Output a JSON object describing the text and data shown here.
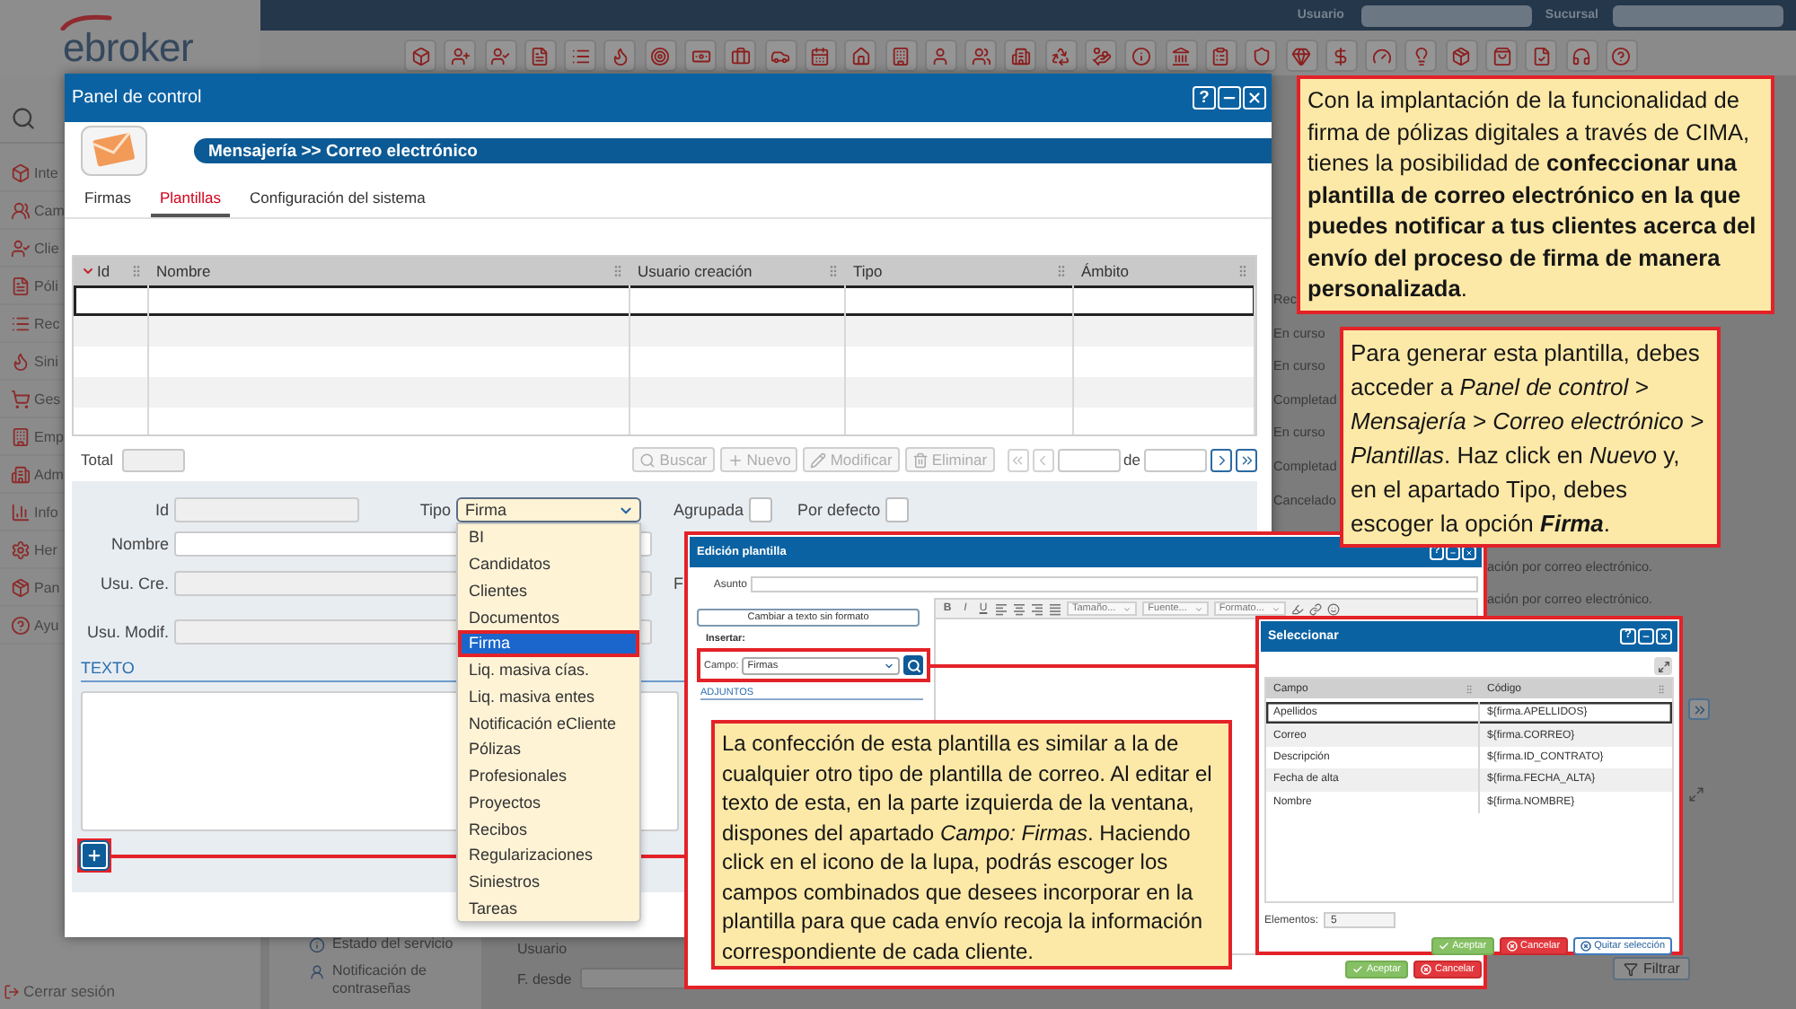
{
  "app": {
    "logo": "ebroker",
    "user_label": "Usuario",
    "branch_label": "Sucursal"
  },
  "sidebar": {
    "items": [
      "Inte",
      "Cam",
      "Clie",
      "Póli",
      "Rec",
      "Sini",
      "Ges",
      "Emp",
      "Adm",
      "Info",
      "Her",
      "Pan",
      "Ayu"
    ],
    "logout": "Cerrar sesión"
  },
  "background": {
    "status_column": [
      "Rec",
      "En curso",
      "En curso",
      "Completad",
      "En curso",
      "Completad",
      "Cancelado"
    ],
    "description_column": [
      "ación por correo electrónico.",
      "ación por correo electrónico."
    ],
    "service_menu": [
      "Estado del servicio",
      "Notificación de contraseñas"
    ],
    "filter_labels": [
      "Usuario",
      "F. desde"
    ],
    "filter_button": "Filtrar"
  },
  "panel": {
    "title": "Panel de control",
    "help_button": "?",
    "breadcrumb": "Mensajería >> Correo electrónico",
    "tabs": [
      {
        "label": "Firmas",
        "selected": false
      },
      {
        "label": "Plantillas",
        "selected": true
      },
      {
        "label": "Configuración del sistema",
        "selected": false
      }
    ],
    "table": {
      "columns": [
        "Id",
        "Nombre",
        "Usuario creación",
        "Tipo",
        "Ámbito"
      ],
      "rows": [
        {
          "selected": true
        },
        {
          "selected": false
        },
        {
          "selected": false
        },
        {
          "selected": false
        },
        {
          "selected": false
        }
      ]
    },
    "total": {
      "label": "Total",
      "disabled": true
    },
    "actions": [
      {
        "kind": "search",
        "label": "Buscar",
        "disabled": true
      },
      {
        "kind": "new",
        "label": "Nuevo",
        "disabled": true
      },
      {
        "kind": "edit",
        "label": "Modificar",
        "disabled": true
      },
      {
        "kind": "delete",
        "label": "Eliminar",
        "disabled": true
      }
    ],
    "pager": {
      "of_label": "de",
      "buttons": [
        {
          "kind": "first",
          "disabled": true
        },
        {
          "kind": "previous",
          "disabled": true
        },
        {
          "kind": "next",
          "disabled": false
        },
        {
          "kind": "last",
          "disabled": false
        }
      ]
    },
    "form": {
      "id": {
        "label": "Id",
        "disabled": true
      },
      "type": {
        "label": "Tipo",
        "value": "Firma",
        "open": true
      },
      "grouped": {
        "label": "Agrupada",
        "checked": false
      },
      "by_default": {
        "label": "Por defecto",
        "checked": false
      },
      "name": {
        "label": "Nombre",
        "disabled": false
      },
      "created_by": {
        "label": "Usu. Cre.",
        "disabled": true
      },
      "cut_label": "F",
      "modified_by": {
        "label": "Usu. Modif.",
        "disabled": true
      },
      "text_heading": "TEXTO"
    },
    "type_options": [
      {
        "label": "BI",
        "selected": false
      },
      {
        "label": "Candidatos",
        "selected": false
      },
      {
        "label": "Clientes",
        "selected": false
      },
      {
        "label": "Documentos",
        "selected": false
      },
      {
        "label": "Firma",
        "selected": true
      },
      {
        "label": "Liq. masiva cías.",
        "selected": false
      },
      {
        "label": "Liq. masiva entes",
        "selected": false
      },
      {
        "label": "Notificación eCliente",
        "selected": false
      },
      {
        "label": "Pólizas",
        "selected": false
      },
      {
        "label": "Profesionales",
        "selected": false
      },
      {
        "label": "Proyectos",
        "selected": false
      },
      {
        "label": "Recibos",
        "selected": false
      },
      {
        "label": "Regularizaciones",
        "selected": false
      },
      {
        "label": "Siniestros",
        "selected": false
      },
      {
        "label": "Tareas",
        "selected": false
      }
    ]
  },
  "template_editor": {
    "title": "Edición plantilla",
    "help_button": "?",
    "subject_label": "Asunto",
    "plain_text_button": "Cambiar a texto sin formato",
    "insert_label": "Insertar:",
    "field_label": "Campo:",
    "field_value": "Firmas",
    "attachments_heading": "ADJUNTOS",
    "format_buttons": [
      "B",
      "I",
      "U"
    ],
    "toolbar_menus": [
      "Tamaño...",
      "Fuente...",
      "Formato..."
    ],
    "buttons": [
      {
        "kind": "accept",
        "label": "Aceptar"
      },
      {
        "kind": "cancel",
        "label": "Cancelar"
      }
    ]
  },
  "select_dialog": {
    "title": "Seleccionar",
    "help_button": "?",
    "columns": [
      "Campo",
      "Código"
    ],
    "rows": [
      {
        "field": "Apellidos",
        "code": "${firma.APELLIDOS}",
        "selected": true
      },
      {
        "field": "Correo",
        "code": "${firma.CORREO}",
        "selected": false
      },
      {
        "field": "Descripción",
        "code": "${firma.ID_CONTRATO}",
        "selected": false
      },
      {
        "field": "Fecha de alta",
        "code": "${firma.FECHA_ALTA}",
        "selected": false
      },
      {
        "field": "Nombre",
        "code": "${firma.NOMBRE}",
        "selected": false
      }
    ],
    "count_label": "Elementos:",
    "count_value": "5",
    "buttons": [
      {
        "kind": "accept",
        "label": "Aceptar"
      },
      {
        "kind": "cancel",
        "label": "Cancelar"
      },
      {
        "kind": "clear",
        "label": "Quitar selección"
      }
    ]
  },
  "callouts": [
    {
      "text": "Con la implantación de la funcionalidad de firma de pólizas digitales a través de CIMA, tienes la posibilidad de **confeccionar una plantilla de correo electrónico en la que puedes notificar a tus clientes acerca del envío del proceso de firma de manera personalizada**.",
      "bold_italic": false
    },
    {
      "text": "Para generar esta plantilla, debes acceder a *Panel de control > Mensajería > Correo electrónico > Plantillas*. Haz click en *Nuevo* y, en el apartado Tipo, debes escoger la opción **Firma**.",
      "bold_italic": true
    },
    {
      "text": "La confección de esta plantilla es similar a la de cualquier otro tipo de plantilla de correo. Al editar el texto de esta, en la parte izquierda de la ventana, dispones del apartado *Campo: Firmas*. Haciendo click en el icono de la lupa, podrás escoger los campos combinados que desees incorporar en la plantilla para que cada envío recoja la información correspondiente de cada cliente."
    }
  ]
}
